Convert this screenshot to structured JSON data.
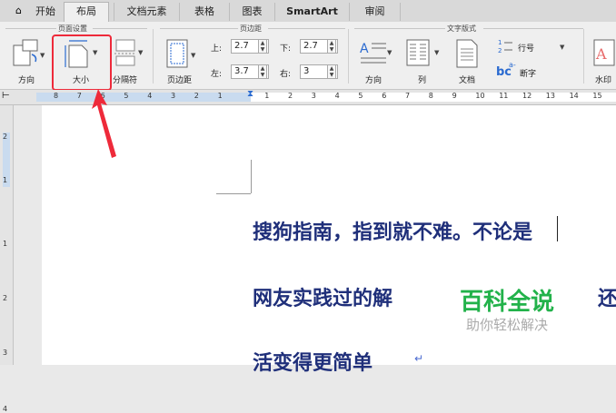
{
  "tabs": [
    {
      "label": "开始",
      "active": false
    },
    {
      "label": "布局",
      "active": true
    },
    {
      "label": "文档元素",
      "active": false
    },
    {
      "label": "表格",
      "active": false
    },
    {
      "label": "图表",
      "active": false
    },
    {
      "label": "SmartArt",
      "active": false
    },
    {
      "label": "审阅",
      "active": false
    }
  ],
  "ribbon": {
    "page_setup": {
      "title": "页面设置",
      "orientation": "方向",
      "size": "大小",
      "breaks": "分隔符"
    },
    "margins": {
      "title": "页边距",
      "margins_button": "页边距",
      "top_label": "上:",
      "top_value": "2.7",
      "bottom_label": "下:",
      "bottom_value": "2.7",
      "left_label": "左:",
      "left_value": "3.7",
      "right_label": "右:",
      "right_value": "3"
    },
    "text_layout": {
      "title": "文字版式",
      "direction": "方向",
      "columns": "列",
      "document": "文档",
      "line_numbers": "行号",
      "hyphenation": "断字",
      "watermark": "水印"
    }
  },
  "ruler": {
    "labels": [
      "8",
      "7",
      "6",
      "5",
      "4",
      "3",
      "2",
      "1",
      "",
      "1",
      "2",
      "3",
      "4",
      "5",
      "6",
      "7",
      "8",
      "9",
      "10",
      "11",
      "12",
      "13",
      "14",
      "15"
    ]
  },
  "vertical_ruler": {
    "labels": [
      "2",
      "1",
      "1",
      "2",
      "3",
      "4"
    ]
  },
  "document": {
    "line1": "搜狗指南，指到就不难。不论是",
    "line2": "网友实践过的解",
    "line2_tail": "还",
    "line3": "活变得更简单",
    "return_mark": "↵"
  },
  "watermark": {
    "title": "百科全说",
    "subtitle": "助你轻松解决"
  },
  "colors": {
    "highlight_box": "#ee2a3a",
    "doc_text": "#1f2f7a",
    "watermark_green": "#22b24a"
  }
}
